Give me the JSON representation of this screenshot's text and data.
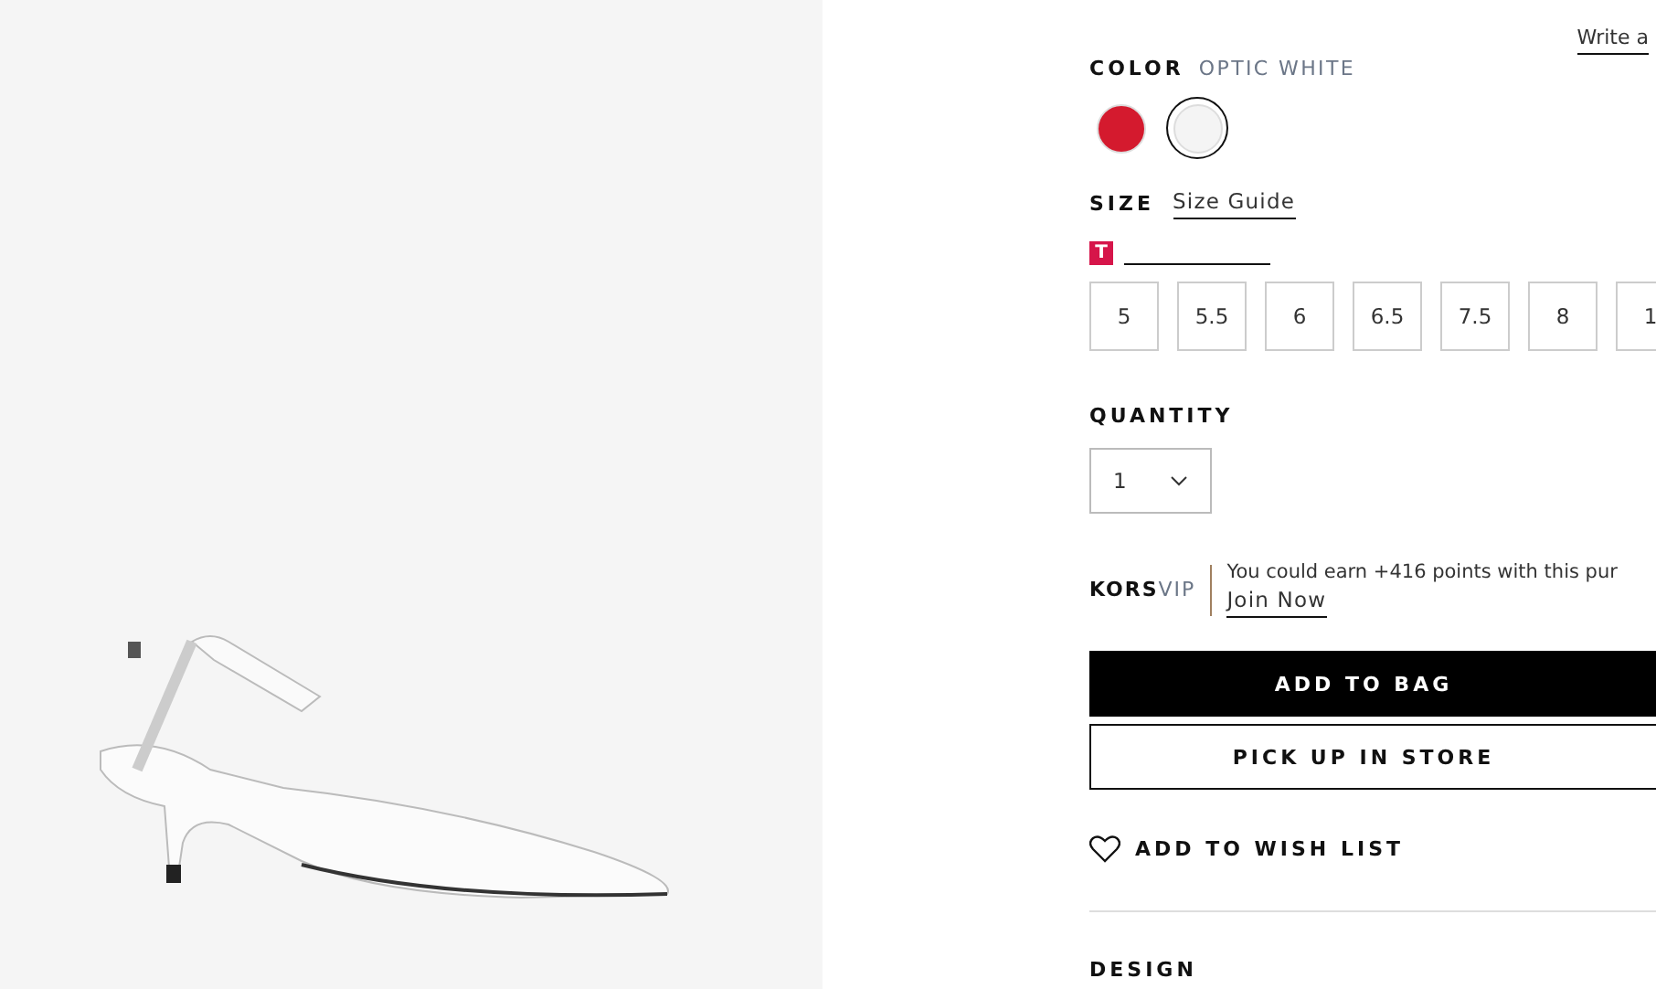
{
  "review_link": "Write a",
  "color": {
    "label": "COLOR",
    "value": "OPTIC WHITE",
    "swatches": [
      {
        "color": "#d41a2e",
        "selected": false
      },
      {
        "color": "#f4f4f4",
        "selected": true
      }
    ]
  },
  "size": {
    "label": "SIZE",
    "guide": "Size Guide",
    "badge": "T",
    "options": [
      {
        "label": "5",
        "selected": false
      },
      {
        "label": "5.5",
        "selected": false
      },
      {
        "label": "6",
        "selected": false
      },
      {
        "label": "6.5",
        "selected": false
      },
      {
        "label": "7.5",
        "selected": false
      },
      {
        "label": "8",
        "selected": false
      },
      {
        "label": "1",
        "selected": false
      }
    ]
  },
  "quantity": {
    "label": "QUANTITY",
    "value": "1"
  },
  "vip": {
    "brand": "KORS",
    "tier": "VIP",
    "message": "You could earn +416 points with this pur",
    "link": "Join Now"
  },
  "buttons": [
    {
      "label": "ADD TO BAG",
      "kind": "primary"
    },
    {
      "label": "PICK UP IN STORE",
      "kind": "secondary"
    }
  ],
  "wishlist": "ADD TO WISH LIST",
  "section": "DESIGN"
}
